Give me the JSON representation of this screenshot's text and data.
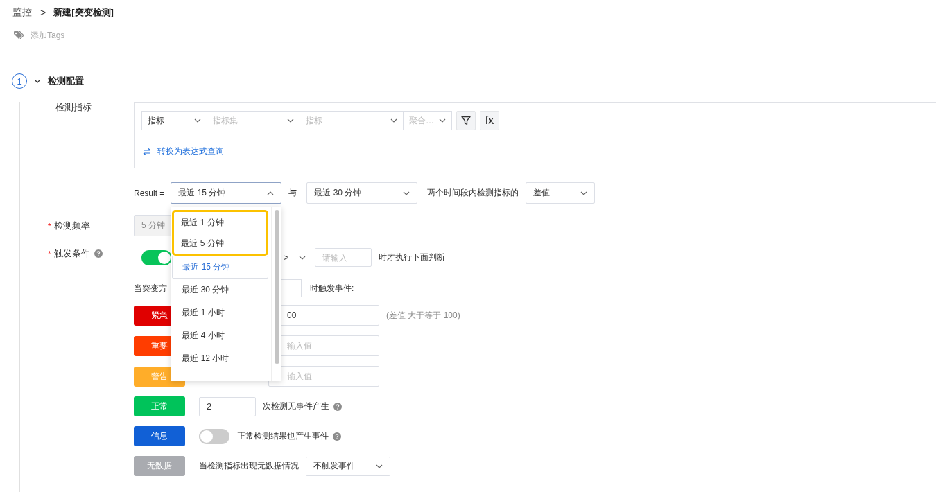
{
  "breadcrumb": {
    "parent": "监控",
    "separator": ">",
    "current": "新建[突变检测]"
  },
  "tags_placeholder": "添加Tags",
  "section": {
    "step": "1",
    "title": "检测配置",
    "expanded": true
  },
  "metric": {
    "label": "检测指标",
    "selects": [
      {
        "value": "指标"
      },
      {
        "placeholder": "指标集"
      },
      {
        "placeholder": "指标"
      },
      {
        "placeholder": "聚合…"
      }
    ],
    "fx_label": "fx",
    "convert_link": "转换为表达式查询"
  },
  "result": {
    "label": "Result =",
    "range_a": "最近 15 分钟",
    "open": true,
    "joiner": "与",
    "range_b": "最近 30 分钟",
    "text": "两个时间段内检测指标的",
    "op": "差值"
  },
  "dropdown": [
    {
      "text": "最近 1 分钟",
      "selected": false,
      "highlighted": true
    },
    {
      "text": "最近 5 分钟",
      "selected": false,
      "highlighted": true
    },
    {
      "text": "最近 15 分钟",
      "selected": true,
      "highlighted": false
    },
    {
      "text": "最近 30 分钟",
      "selected": false,
      "highlighted": false
    },
    {
      "text": "最近 1 小时",
      "selected": false,
      "highlighted": false
    },
    {
      "text": "最近 4 小时",
      "selected": false,
      "highlighted": false
    },
    {
      "text": "最近 12 小时",
      "selected": false,
      "highlighted": false
    }
  ],
  "frequency": {
    "label": "检测频率",
    "required_mark": "*",
    "value": "5 分钟",
    "disabled": true
  },
  "trigger": {
    "label": "触发条件",
    "required_mark": "*",
    "on": true,
    "comparator": ">",
    "placeholder": "请输入",
    "text": "时才执行下面判断"
  },
  "direction": {
    "label": "当突变方",
    "suffix": "时触发事件:"
  },
  "levels": [
    {
      "kind": "threshold",
      "name": "紧急",
      "color": "#e00000",
      "value": "00",
      "note": "(差值 大于等于 100)"
    },
    {
      "kind": "threshold",
      "name": "重要",
      "color": "#ff3d00",
      "placeholder": "输入值"
    },
    {
      "kind": "threshold",
      "name": "警告",
      "color": "#ffad29",
      "placeholder": "输入值"
    },
    {
      "kind": "count",
      "name": "正常",
      "color": "#00c35a",
      "value": "2",
      "text": "次检测无事件产生"
    },
    {
      "kind": "switch",
      "name": "信息",
      "color": "#1160d6",
      "on": false,
      "text": "正常检测结果也产生事件"
    },
    {
      "kind": "nodata",
      "name": "无数据",
      "color": "#a9abb0",
      "text": "当检测指标出现无数据情况",
      "select": "不触发事件"
    }
  ]
}
